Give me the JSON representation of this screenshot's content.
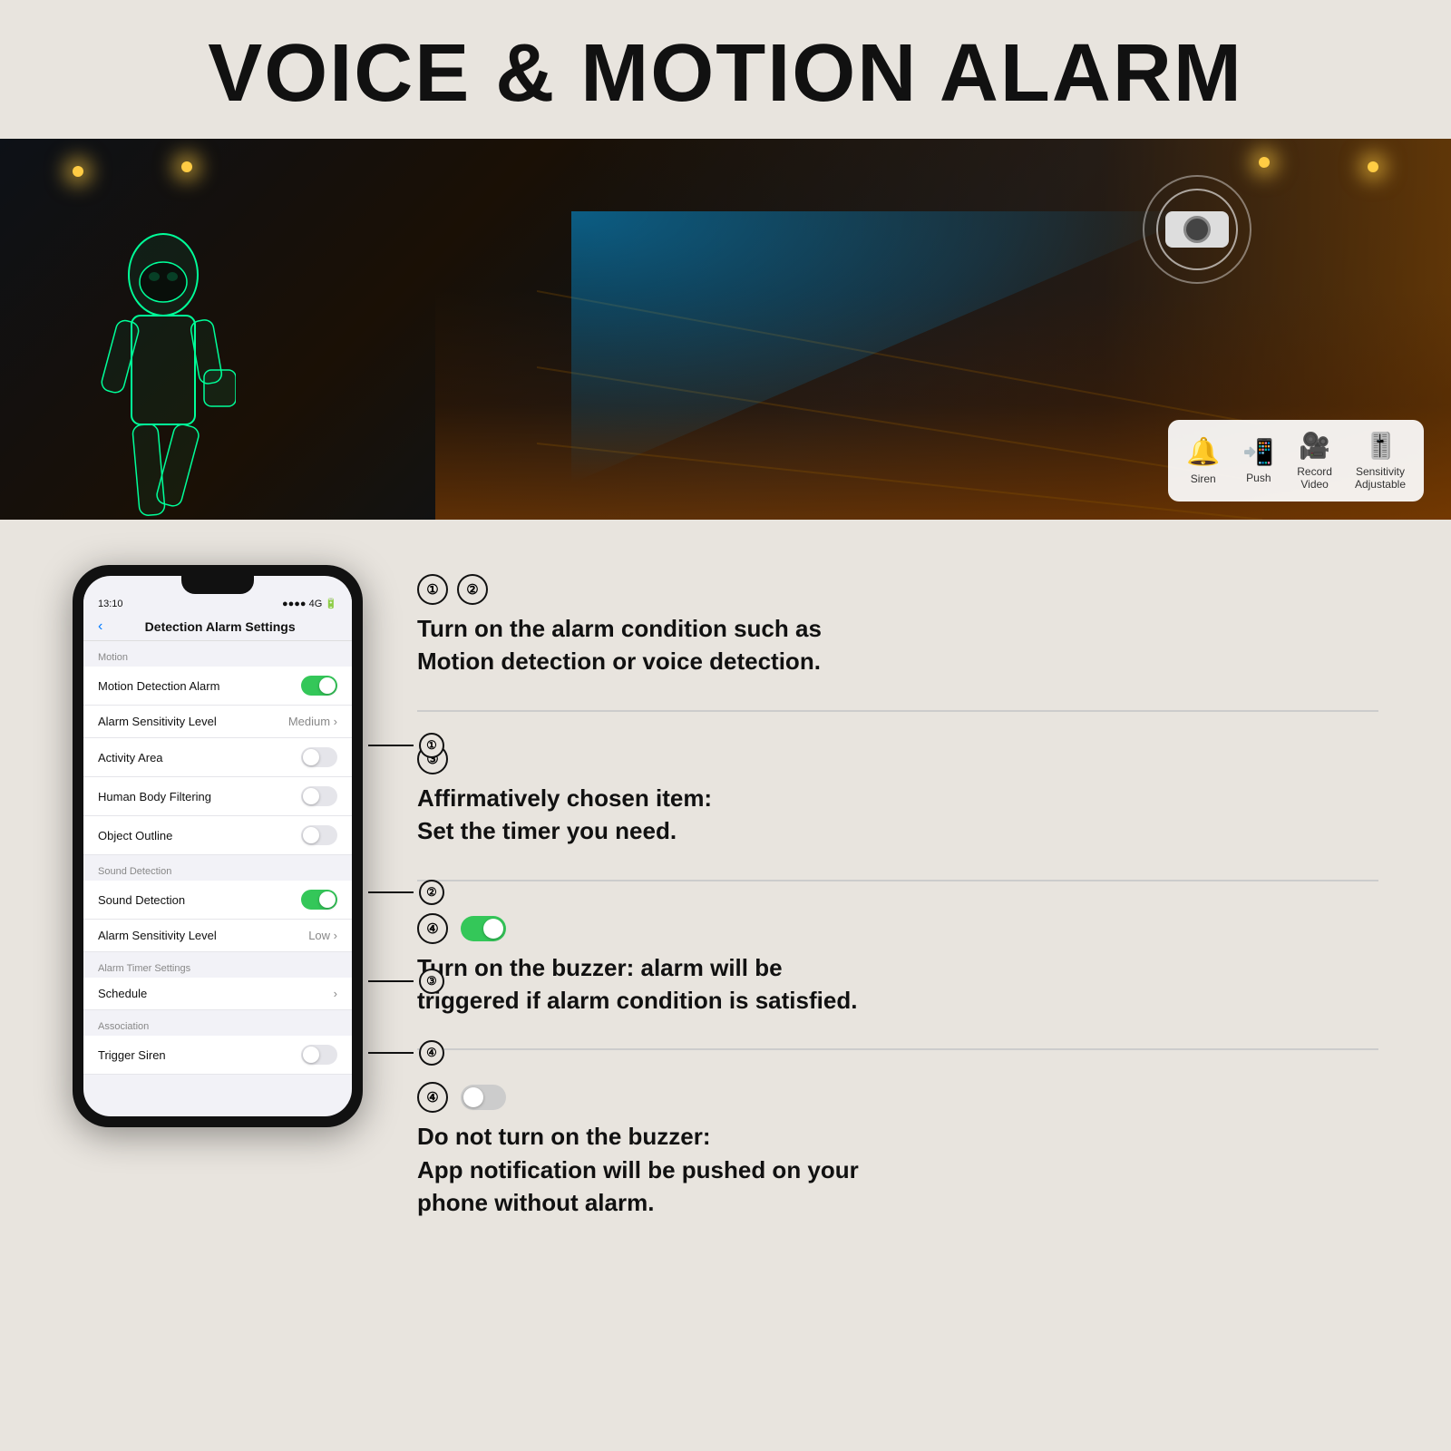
{
  "title": "VOICE & MOTION ALARM",
  "hero": {
    "action_icons": [
      {
        "id": "siren",
        "symbol": "🔔",
        "label": "Siren",
        "color": "#cc2200"
      },
      {
        "id": "push",
        "symbol": "📱",
        "label": "Push"
      },
      {
        "id": "record",
        "symbol": "🎥",
        "label": "Record\nVideo"
      },
      {
        "id": "sensitivity",
        "symbol": "🎚",
        "label": "Sensitivity\nAdjustable"
      }
    ]
  },
  "phone": {
    "status_time": "13:10",
    "status_signal": "●●●● 4G",
    "nav_title": "Detection Alarm Settings",
    "sections": [
      {
        "header": "Motion",
        "items": [
          {
            "label": "Motion Detection Alarm",
            "type": "toggle",
            "value": "on",
            "callout": "①"
          },
          {
            "label": "Alarm Sensitivity Level",
            "type": "value",
            "value": "Medium >"
          },
          {
            "label": "Activity Area",
            "type": "toggle",
            "value": "off"
          },
          {
            "label": "Human Body Filtering",
            "type": "toggle",
            "value": "off"
          },
          {
            "label": "Object Outline",
            "type": "toggle",
            "value": "off"
          }
        ]
      },
      {
        "header": "Sound Detection",
        "items": [
          {
            "label": "Sound Detection",
            "type": "toggle",
            "value": "on",
            "callout": "②"
          },
          {
            "label": "Alarm Sensitivity Level",
            "type": "value",
            "value": "Low >"
          }
        ]
      },
      {
        "header": "Alarm Timer Settings",
        "items": [
          {
            "label": "Schedule",
            "type": "arrow",
            "value": ">",
            "callout": "③"
          }
        ]
      },
      {
        "header": "Association",
        "items": [
          {
            "label": "Trigger Siren",
            "type": "toggle",
            "value": "off",
            "callout": "④"
          }
        ]
      }
    ]
  },
  "info_blocks": [
    {
      "id": "block1",
      "numbers": [
        "①",
        "②"
      ],
      "text": "Turn on the alarm condition such as\nMotion detection or voice detection."
    },
    {
      "id": "block2",
      "numbers": [
        "③"
      ],
      "text": "Affirmatively chosen item:\nSet the timer you need."
    },
    {
      "id": "block3-on",
      "numbers": [
        "④"
      ],
      "toggle_state": "on",
      "text": "Turn on the buzzer: alarm will be\ntriggered if alarm condition is satisfied."
    },
    {
      "id": "block4-off",
      "numbers": [
        "④"
      ],
      "toggle_state": "off",
      "text": "Do not turn on the buzzer:\nApp notification will be pushed on your\nphone without alarm."
    }
  ]
}
